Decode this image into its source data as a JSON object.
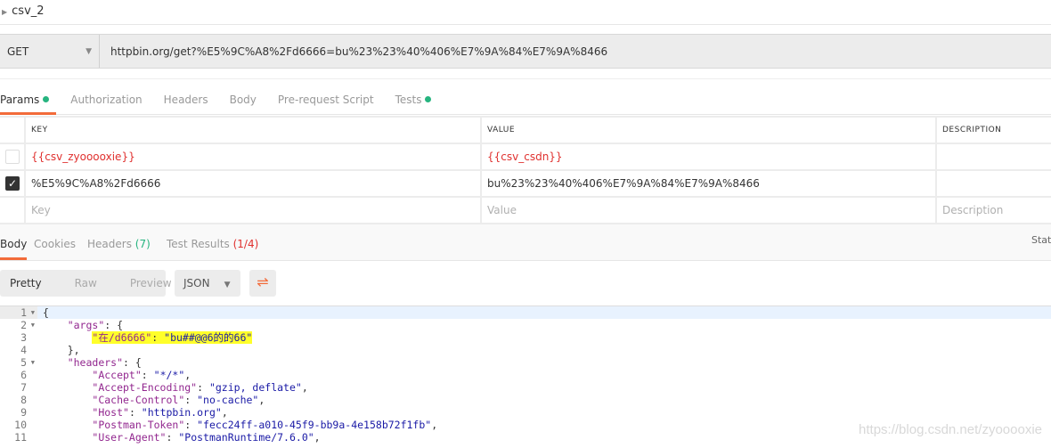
{
  "title": "csv_2",
  "request": {
    "method": "GET",
    "url": "httpbin.org/get?%E5%9C%A8%2Fd6666=bu%23%23%40%406%E7%9A%84%E7%9A%8466"
  },
  "tabs": [
    {
      "label": "Params",
      "dot": true
    },
    {
      "label": "Authorization"
    },
    {
      "label": "Headers"
    },
    {
      "label": "Body"
    },
    {
      "label": "Pre-request Script"
    },
    {
      "label": "Tests",
      "dot": true
    }
  ],
  "params": {
    "headers": [
      "KEY",
      "VALUE",
      "DESCRIPTION"
    ],
    "rows": [
      {
        "checked": false,
        "key": "{{csv_zyooooxie}}",
        "value": "{{csv_csdn}}",
        "description": ""
      },
      {
        "checked": true,
        "key": "%E5%9C%A8%2Fd6666",
        "value": "bu%23%23%40%406%E7%9A%84%E7%9A%8466",
        "description": ""
      }
    ],
    "placeholders": {
      "key": "Key",
      "value": "Value",
      "description": "Description"
    }
  },
  "response": {
    "tabs": {
      "body": "Body",
      "cookies": "Cookies",
      "headers": "Headers",
      "headers_count": "(7)",
      "tests": "Test Results",
      "tests_count": "(1/4)"
    },
    "status_label": "Status",
    "views": [
      "Pretty",
      "Raw",
      "Preview"
    ],
    "format": "JSON",
    "lines": [
      {
        "n": "1",
        "fold": true,
        "parts": [
          [
            "p",
            "{"
          ]
        ]
      },
      {
        "n": "2",
        "fold": true,
        "parts": [
          [
            "p",
            "    "
          ],
          [
            "k",
            "\"args\""
          ],
          [
            "p",
            ": {"
          ]
        ]
      },
      {
        "n": "3",
        "parts": [
          [
            "p",
            "        "
          ],
          [
            "k",
            "\"在/d6666\"",
            "hl"
          ],
          [
            "p",
            ": ",
            "hl"
          ],
          [
            "s",
            "\"bu##@@6的的66\"",
            "hl"
          ]
        ]
      },
      {
        "n": "4",
        "parts": [
          [
            "p",
            "    },"
          ]
        ]
      },
      {
        "n": "5",
        "fold": true,
        "parts": [
          [
            "p",
            "    "
          ],
          [
            "k",
            "\"headers\""
          ],
          [
            "p",
            ": {"
          ]
        ]
      },
      {
        "n": "6",
        "parts": [
          [
            "p",
            "        "
          ],
          [
            "k",
            "\"Accept\""
          ],
          [
            "p",
            ": "
          ],
          [
            "s",
            "\"*/*\""
          ],
          [
            "p",
            ","
          ]
        ]
      },
      {
        "n": "7",
        "parts": [
          [
            "p",
            "        "
          ],
          [
            "k",
            "\"Accept-Encoding\""
          ],
          [
            "p",
            ": "
          ],
          [
            "s",
            "\"gzip, deflate\""
          ],
          [
            "p",
            ","
          ]
        ]
      },
      {
        "n": "8",
        "parts": [
          [
            "p",
            "        "
          ],
          [
            "k",
            "\"Cache-Control\""
          ],
          [
            "p",
            ": "
          ],
          [
            "s",
            "\"no-cache\""
          ],
          [
            "p",
            ","
          ]
        ]
      },
      {
        "n": "9",
        "parts": [
          [
            "p",
            "        "
          ],
          [
            "k",
            "\"Host\""
          ],
          [
            "p",
            ": "
          ],
          [
            "s",
            "\"httpbin.org\""
          ],
          [
            "p",
            ","
          ]
        ]
      },
      {
        "n": "10",
        "parts": [
          [
            "p",
            "        "
          ],
          [
            "k",
            "\"Postman-Token\""
          ],
          [
            "p",
            ": "
          ],
          [
            "s",
            "\"fecc24ff-a010-45f9-bb9a-4e158b72f1fb\""
          ],
          [
            "p",
            ","
          ]
        ]
      },
      {
        "n": "11",
        "parts": [
          [
            "p",
            "        "
          ],
          [
            "k",
            "\"User-Agent\""
          ],
          [
            "p",
            ": "
          ],
          [
            "s",
            "\"PostmanRuntime/7.6.0\""
          ],
          [
            "p",
            ","
          ]
        ]
      }
    ]
  },
  "watermark": "https://blog.csdn.net/zyooooxie",
  "colors": {
    "accent": "#f26b3a",
    "green": "#26b47f",
    "red": "#e0312f",
    "highlight": "#ffff2a"
  }
}
